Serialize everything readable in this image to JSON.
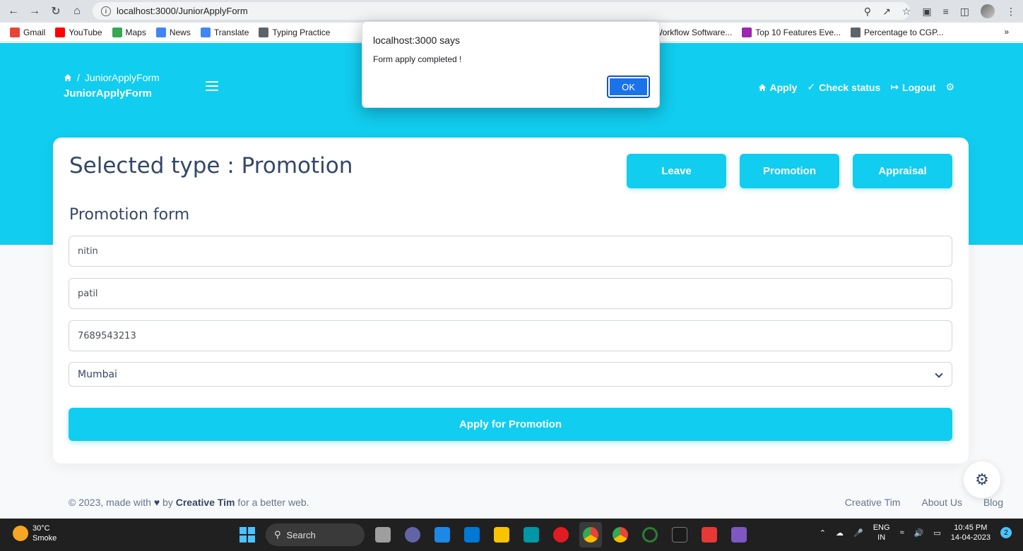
{
  "browser": {
    "url": "localhost:3000/JuniorApplyForm",
    "bookmarks": [
      {
        "label": "Gmail",
        "icon": "gmail-icon",
        "color": "#ea4335"
      },
      {
        "label": "YouTube",
        "icon": "youtube-icon",
        "color": "#ff0000"
      },
      {
        "label": "Maps",
        "icon": "maps-icon",
        "color": "#34a853"
      },
      {
        "label": "News",
        "icon": "news-icon",
        "color": "#4285f4"
      },
      {
        "label": "Translate",
        "icon": "translate-icon",
        "color": "#4285f4"
      },
      {
        "label": "Typing Practice",
        "icon": "keyboard-icon",
        "color": "#5f6368"
      },
      {
        "label": "Workflow Software...",
        "icon": "workflow-icon",
        "color": "#9c27b0"
      },
      {
        "label": "Top 10 Features Eve...",
        "icon": "workflow-icon",
        "color": "#9c27b0"
      },
      {
        "label": "Percentage to CGP...",
        "icon": "calc-icon",
        "color": "#5f6368"
      }
    ]
  },
  "dialog": {
    "title": "localhost:3000 says",
    "message": "Form apply completed !",
    "ok_label": "OK"
  },
  "header": {
    "breadcrumb_current": "JuniorApplyForm",
    "page_title": "JuniorApplyForm",
    "nav": {
      "apply": "Apply",
      "check_status": "Check status",
      "logout": "Logout"
    }
  },
  "card": {
    "selected_type_title": "Selected type : Promotion",
    "type_buttons": [
      "Leave",
      "Promotion",
      "Appraisal"
    ],
    "form_title": "Promotion form",
    "fields": {
      "first_name": "nitin",
      "last_name": "patil",
      "phone": "7689543213",
      "city": "Mumbai"
    },
    "submit_label": "Apply for Promotion"
  },
  "footer": {
    "copyright_prefix": "© 2023, made with",
    "by": "by",
    "brand": "Creative Tim",
    "suffix": "for a better web.",
    "links": [
      "Creative Tim",
      "About Us",
      "Blog"
    ]
  },
  "taskbar": {
    "weather_temp": "30°C",
    "weather_desc": "Smoke",
    "search_label": "Search",
    "lang_top": "ENG",
    "lang_bottom": "IN",
    "time": "10:45 PM",
    "date": "14-04-2023",
    "notification_count": "2"
  }
}
